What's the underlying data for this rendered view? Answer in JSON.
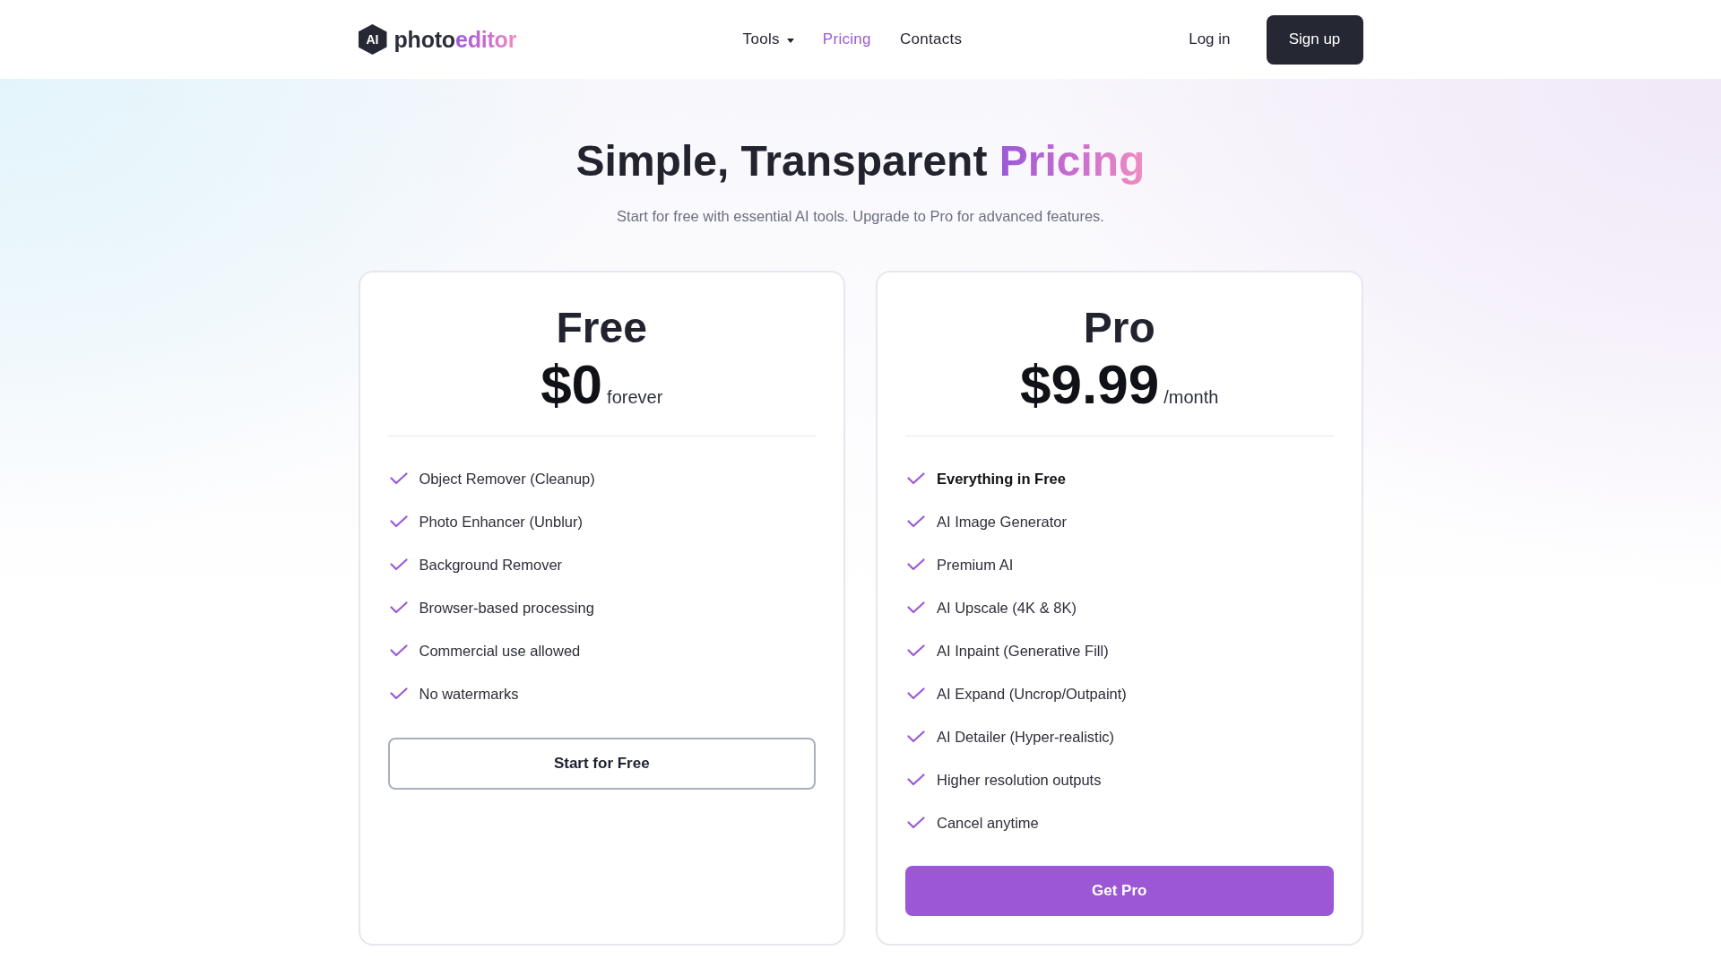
{
  "header": {
    "logo": {
      "mark": "AI",
      "text": "photo",
      "accent": "editor"
    },
    "nav": [
      {
        "label": "Tools",
        "kind": "dropdown",
        "selected": false
      },
      {
        "label": "Pricing",
        "kind": "link",
        "selected": true
      },
      {
        "label": "Contacts",
        "kind": "link",
        "selected": false
      }
    ],
    "login": "Log in",
    "signup": "Sign up"
  },
  "hero": {
    "title": "Simple, Transparent",
    "title_accent": "Pricing",
    "subtitle": "Start for free with essential AI tools. Upgrade to Pro for advanced features."
  },
  "plans": [
    {
      "name": "Free",
      "price": "$0",
      "period": "forever",
      "features": [
        {
          "text": "Object Remover (Cleanup)",
          "emphasized": false
        },
        {
          "text": "Photo Enhancer (Unblur)",
          "emphasized": false
        },
        {
          "text": "Background Remover",
          "emphasized": false
        },
        {
          "text": "Browser-based processing",
          "emphasized": false
        },
        {
          "text": "Commercial use allowed",
          "emphasized": false
        },
        {
          "text": "No watermarks",
          "emphasized": false
        }
      ],
      "button": {
        "label": "Start for Free",
        "kind": "outline"
      }
    },
    {
      "name": "Pro",
      "price": "$9.99",
      "period": "/month",
      "features": [
        {
          "text": "Everything in Free",
          "emphasized": true
        },
        {
          "text": "AI Image Generator",
          "emphasized": false
        },
        {
          "text": "Premium AI",
          "emphasized": false
        },
        {
          "text": "AI Upscale (4K & 8K)",
          "emphasized": false
        },
        {
          "text": "AI Inpaint (Generative Fill)",
          "emphasized": false
        },
        {
          "text": "AI Expand (Uncrop/Outpaint)",
          "emphasized": false
        },
        {
          "text": "AI Detailer (Hyper-realistic)",
          "emphasized": false
        },
        {
          "text": "Higher resolution outputs",
          "emphasized": false
        },
        {
          "text": "Cancel anytime",
          "emphasized": false
        }
      ],
      "button": {
        "label": "Get Pro",
        "kind": "filled"
      }
    }
  ]
}
